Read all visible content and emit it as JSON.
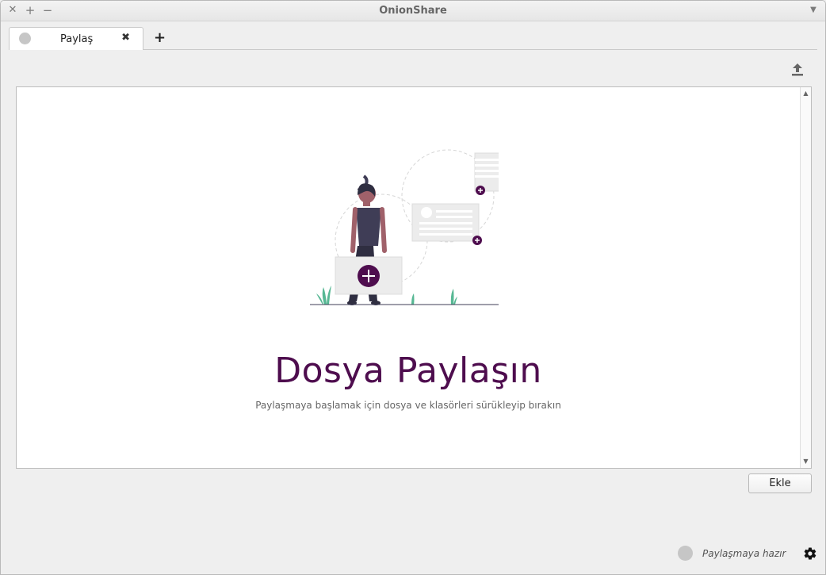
{
  "window": {
    "title": "OnionShare",
    "close_glyph": "✕",
    "maximize_glyph": "+",
    "minimize_glyph": "−",
    "menu_glyph": "▼"
  },
  "tabs": [
    {
      "label": "Paylaş",
      "close_glyph": "✖"
    }
  ],
  "new_tab_glyph": "+",
  "toolbar": {
    "upload_icon": "upload-icon"
  },
  "drop_area": {
    "headline": "Dosya Paylaşın",
    "subline": "Paylaşmaya başlamak için dosya ve klasörleri sürükleyip bırakın",
    "accent_color": "#4e0d4e",
    "illustration_icon": "person-holding-file-illustration"
  },
  "buttons": {
    "add_label": "Ekle"
  },
  "status": {
    "text": "Paylaşmaya hazır",
    "settings_icon": "gear-icon"
  }
}
